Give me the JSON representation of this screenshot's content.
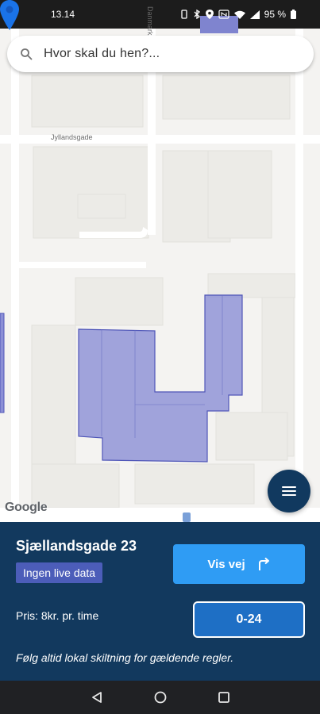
{
  "status_bar": {
    "time": "13.14",
    "battery": "95 %"
  },
  "search": {
    "placeholder": "Hvor skal du hen?..."
  },
  "map": {
    "street_horizontal": "Jyllandsgade",
    "street_vertical": "Danmarksgade",
    "attribution": "Google",
    "zone_color": "#8b8fd6",
    "pin_color": "#1a73e8"
  },
  "panel": {
    "address": "Sjællandsgade 23",
    "live_badge": "Ingen live data",
    "route_button": "Vis vej",
    "price": "Pris: 8kr. pr. time",
    "hours_button": "0-24",
    "notice": "Følg altid lokal skiltning for gældende regler."
  },
  "icons": {
    "search": "search-icon",
    "menu": "hamburger-menu-icon",
    "route": "turn-right-arrow-icon",
    "back": "back-triangle-icon",
    "home": "home-circle-icon",
    "recents": "recents-square-icon"
  },
  "colors": {
    "panel_bg": "#12395e",
    "badge_bg": "#4c5db9",
    "route_button_bg": "#2f9cf4",
    "hours_button_bg": "#1e6fc5",
    "fab_bg": "#11395f"
  }
}
